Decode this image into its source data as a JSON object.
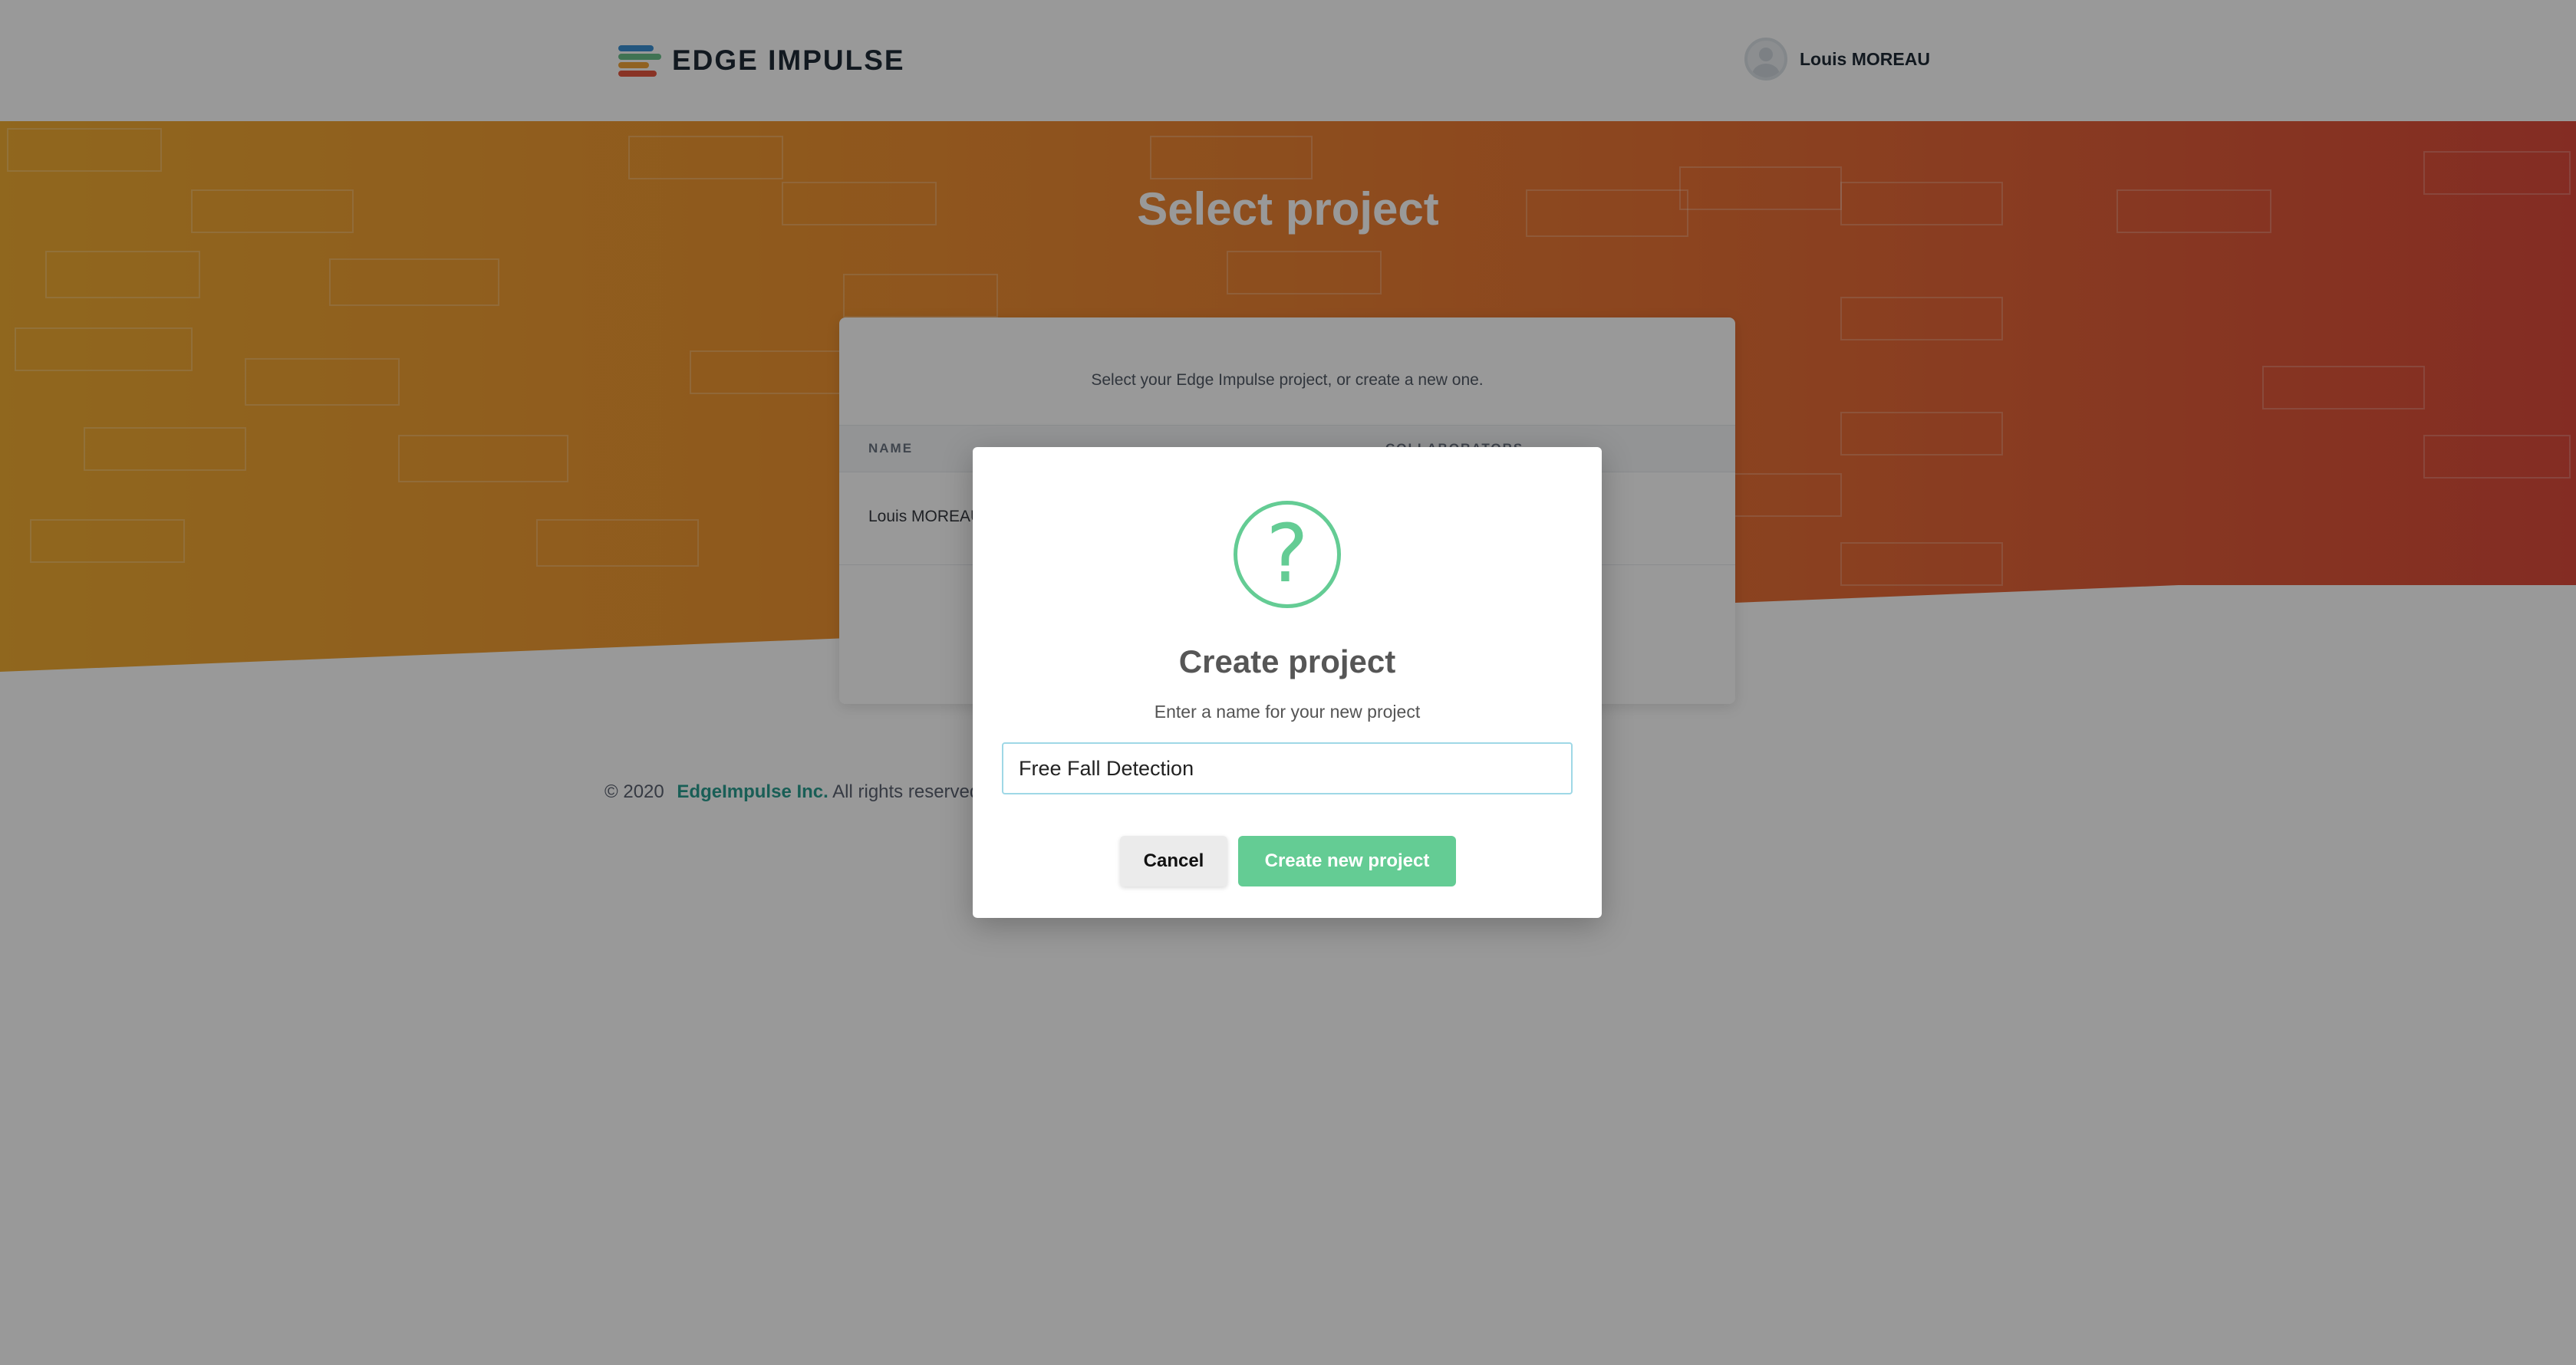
{
  "header": {
    "logo_text": "EDGE IMPULSE",
    "logo_icon": "edge-impulse-bars-icon",
    "user_name": "Louis MOREAU",
    "avatar_icon": "user-avatar-icon"
  },
  "page": {
    "title": "Select project",
    "intro": "Select your Edge Impulse project, or create a new one.",
    "table": {
      "columns": [
        "NAME",
        "COLLABORATORS"
      ],
      "rows": [
        {
          "name": "Louis MOREAU"
        }
      ]
    }
  },
  "footer": {
    "copyright": "© 2020",
    "company": "EdgeImpulse Inc.",
    "rights": "All rights reserved"
  },
  "modal": {
    "icon": "question-circle-icon",
    "icon_glyph": "?",
    "title": "Create project",
    "subtitle": "Enter a name for your new project",
    "input_value": "Free Fall Detection",
    "cancel_label": "Cancel",
    "create_label": "Create new project"
  },
  "colors": {
    "accent_green": "#64cc94",
    "hero_gradient_start": "#f1ac33",
    "hero_gradient_end": "#dc4a3b",
    "link_teal": "#2a9d8f"
  }
}
